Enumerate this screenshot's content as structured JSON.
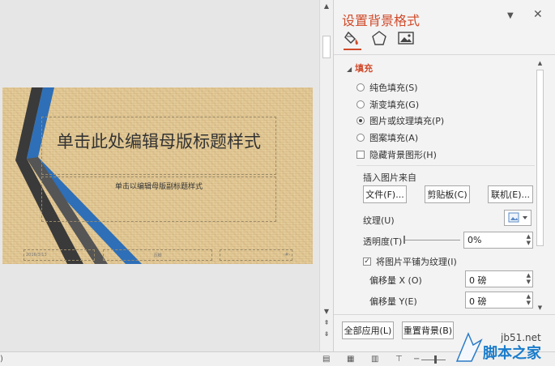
{
  "slide": {
    "title": "单击此处编辑母版标题样式",
    "subtitle": "单击以编辑母版副标题样式",
    "footer_date": "2016/3/13",
    "footer_center": "页脚",
    "footer_number": "‹#›"
  },
  "pane": {
    "title": "设置背景格式",
    "tabs": [
      "fill-icon",
      "pentagon-icon",
      "picture-icon"
    ],
    "section": "填充",
    "fill_options": [
      {
        "label": "纯色填充(S)",
        "selected": false
      },
      {
        "label": "渐变填充(G)",
        "selected": false
      },
      {
        "label": "图片或纹理填充(P)",
        "selected": true
      },
      {
        "label": "图案填充(A)",
        "selected": false
      }
    ],
    "hide_bg_graphics": "隐藏背景图形(H)",
    "insert_from_label": "插入图片来自",
    "file_button": "文件(F)...",
    "clipboard_button": "剪贴板(C)",
    "online_button": "联机(E)...",
    "texture_label": "纹理(U)",
    "transparency_label": "透明度(T)",
    "transparency_value": "0%",
    "tile_label": "将图片平铺为纹理(I)",
    "tile_checked": true,
    "offset_x_label": "偏移量 X (O)",
    "offset_x_value": "0 磅",
    "offset_y_label": "偏移量 Y(E)",
    "offset_y_value": "0 磅",
    "apply_all_button": "全部应用(L)",
    "reset_button": "重置背景(B)"
  },
  "watermark": {
    "url": "jb51.net",
    "text": "脚本之家"
  },
  "status": {
    "left_fragment": ")"
  },
  "colors": {
    "accent": "#d04a2a",
    "slide_bg": "#e2c894",
    "stripe_blue": "#2e6fb8",
    "stripe_dark": "#3a3a3a",
    "watermark_blue": "#1a7ccb"
  }
}
